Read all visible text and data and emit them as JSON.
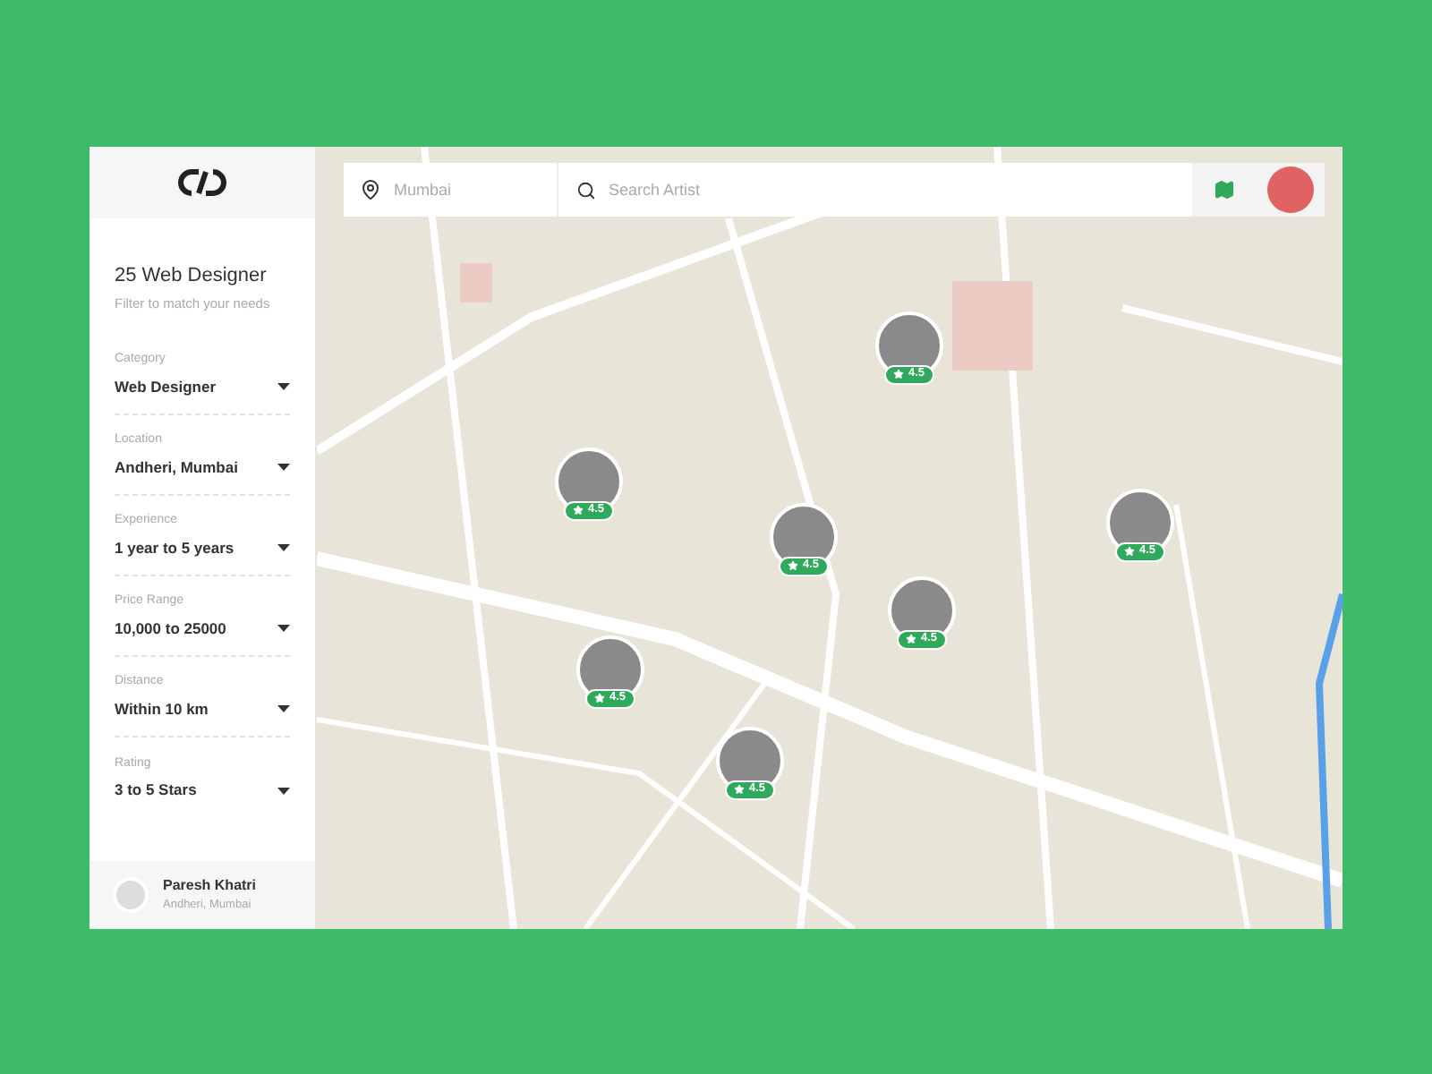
{
  "sidebar": {
    "title": "25 Web Designer",
    "subtitle": "Filter to match your needs",
    "filters": [
      {
        "label": "Category",
        "value": "Web Designer"
      },
      {
        "label": "Location",
        "value": "Andheri, Mumbai"
      },
      {
        "label": "Experience",
        "value": "1 year to 5 years"
      },
      {
        "label": "Price Range",
        "value": "10,000 to 25000"
      },
      {
        "label": "Distance",
        "value": "Within 10 km"
      },
      {
        "label": "Rating",
        "value": "3 to 5 Stars"
      }
    ],
    "user": {
      "name": "Paresh Khatri",
      "location": "Andheri, Mumbai"
    }
  },
  "search_bar": {
    "location_placeholder": "Mumbai",
    "search_placeholder": "Search Artist"
  },
  "pins": [
    {
      "rating": "4.5"
    },
    {
      "rating": "4.5"
    },
    {
      "rating": "4.5"
    },
    {
      "rating": "4.5"
    },
    {
      "rating": "4.5"
    },
    {
      "rating": "4.5"
    },
    {
      "rating": "4.5"
    }
  ]
}
